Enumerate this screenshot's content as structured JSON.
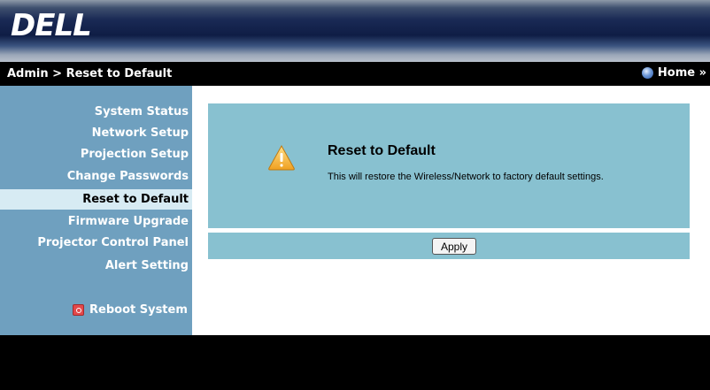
{
  "header": {
    "logo": "DELL"
  },
  "titlebar": {
    "breadcrumb": "Admin > Reset to Default",
    "home": "Home »"
  },
  "sidebar": {
    "items": [
      {
        "label": "System Status"
      },
      {
        "label": "Network Setup"
      },
      {
        "label": "Projection Setup"
      },
      {
        "label": "Change Passwords"
      },
      {
        "label": "Reset to Default",
        "active": true
      },
      {
        "label": "Firmware Upgrade"
      },
      {
        "label": "Projector Control Panel"
      },
      {
        "label": "Alert Setting"
      }
    ],
    "reboot": "Reboot System"
  },
  "main": {
    "title": "Reset to Default",
    "description": "This will restore the Wireless/Network to factory default settings.",
    "apply_label": "Apply"
  },
  "colors": {
    "sidebar": "#6fa0bf",
    "active_item": "#d7ebf3",
    "panel": "#88c1d0"
  }
}
